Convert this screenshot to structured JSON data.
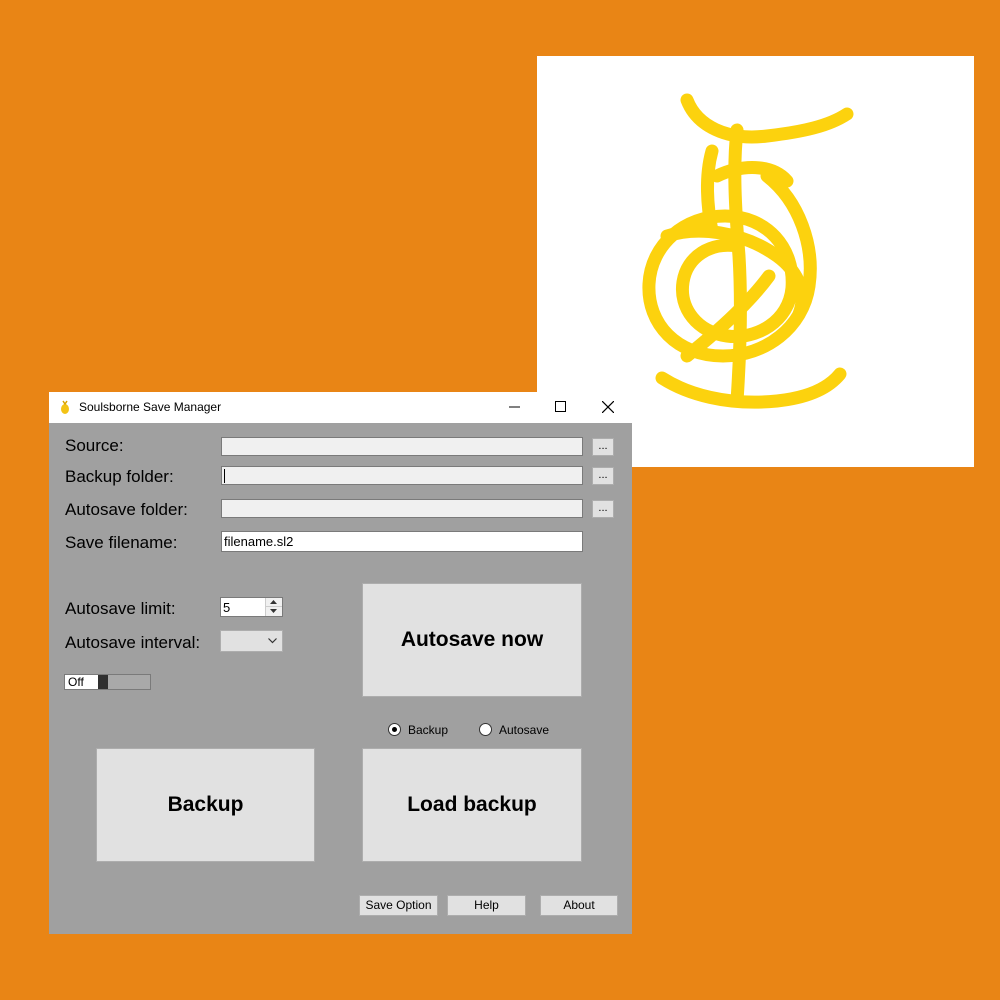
{
  "window": {
    "title": "Soulsborne Save Manager",
    "controls": [
      "minimize-icon",
      "maximize-icon",
      "close-icon"
    ]
  },
  "fields": {
    "source_label": "Source:",
    "source_value": "",
    "backup_folder_label": "Backup folder:",
    "backup_folder_value": "",
    "autosave_folder_label": "Autosave folder:",
    "autosave_folder_value": "",
    "save_filename_label": "Save filename:",
    "save_filename_value": "filename.sl2",
    "browse_label": "..."
  },
  "autosave": {
    "limit_label": "Autosave limit:",
    "limit_value": "5",
    "interval_label": "Autosave interval:",
    "interval_value": "",
    "toggle_label": "Off",
    "autosave_now_label": "Autosave now"
  },
  "load_mode": {
    "options": [
      "Backup",
      "Autosave"
    ],
    "selected": "Backup"
  },
  "actions": {
    "backup_label": "Backup",
    "load_backup_label": "Load backup",
    "save_option_label": "Save Option",
    "help_label": "Help",
    "about_label": "About"
  },
  "colors": {
    "background": "#e98515",
    "window_body": "#a0a0a0",
    "logo_stroke": "#fcd20e"
  },
  "logo": {
    "icon": "rune-logo-icon"
  }
}
